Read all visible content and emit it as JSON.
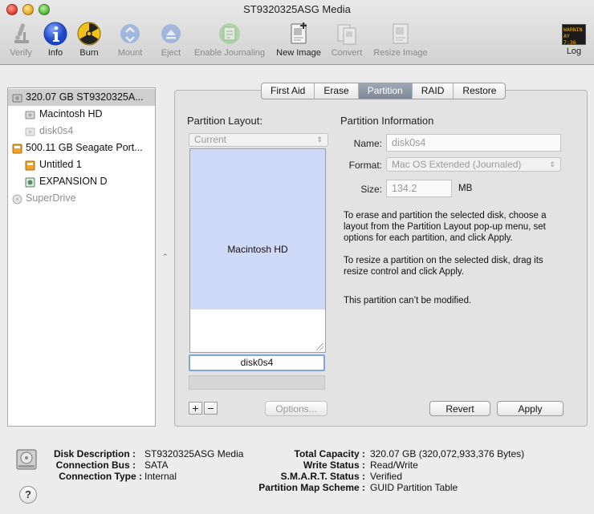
{
  "window": {
    "title": "ST9320325ASG Media"
  },
  "toolbar": {
    "verify": "Verify",
    "info": "Info",
    "burn": "Burn",
    "mount": "Mount",
    "eject": "Eject",
    "enable_journaling": "Enable Journaling",
    "new_image": "New Image",
    "convert": "Convert",
    "resize_image": "Resize Image",
    "log": "Log",
    "log_badge": [
      "WARNIN",
      "AY 7:36"
    ]
  },
  "sidebar": {
    "items": [
      {
        "label": "320.07 GB ST9320325A...",
        "icon": "internal-disk-icon"
      },
      {
        "label": "Macintosh HD",
        "icon": "volume-icon"
      },
      {
        "label": "disk0s4",
        "icon": "volume-icon"
      },
      {
        "label": "500.11 GB Seagate Port...",
        "icon": "external-disk-icon"
      },
      {
        "label": "Untitled 1",
        "icon": "external-volume-icon"
      },
      {
        "label": "EXPANSION D",
        "icon": "disk-image-icon"
      },
      {
        "label": "SuperDrive",
        "icon": "optical-drive-icon"
      }
    ]
  },
  "tabs": [
    "First Aid",
    "Erase",
    "Partition",
    "RAID",
    "Restore"
  ],
  "partition": {
    "layout_heading": "Partition Layout:",
    "layout_popup": "Current",
    "partition_block_label": "Macintosh HD",
    "selected_name": "disk0s4",
    "add_label": "+",
    "remove_label": "−",
    "options_label": "Options...",
    "info_heading": "Partition Information",
    "name_label": "Name:",
    "name_value": "disk0s4",
    "format_label": "Format:",
    "format_value": "Mac OS Extended (Journaled)",
    "size_label": "Size:",
    "size_value": "134.2",
    "size_unit": "MB",
    "info_text_1": "To erase and partition the selected disk, choose a layout from the Partition Layout pop-up menu, set options for each partition, and click Apply.",
    "info_text_2": "To resize a partition on the selected disk, drag its resize control and click Apply.",
    "info_text_3": "This partition can’t be modified.",
    "revert_label": "Revert",
    "apply_label": "Apply"
  },
  "footer": {
    "disk_description_label": "Disk Description :",
    "disk_description": "ST9320325ASG Media",
    "connection_bus_label": "Connection Bus :",
    "connection_bus": "SATA",
    "connection_type_label": "Connection Type :",
    "connection_type": "Internal",
    "total_capacity_label": "Total Capacity :",
    "total_capacity": "320.07 GB (320,072,933,376 Bytes)",
    "write_status_label": "Write Status :",
    "write_status": "Read/Write",
    "smart_status_label": "S.M.A.R.T. Status :",
    "smart_status": "Verified",
    "partition_map_label": "Partition Map Scheme :",
    "partition_map": "GUID Partition Table",
    "help_label": "?"
  }
}
